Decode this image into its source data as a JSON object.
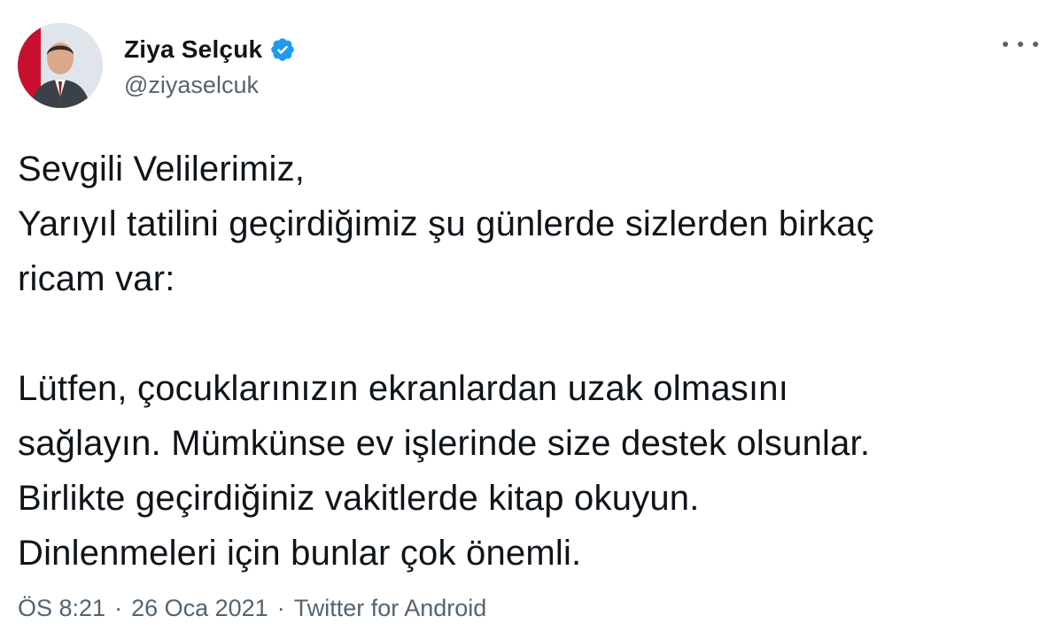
{
  "author": {
    "display_name": "Ziya Selçuk",
    "handle": "@ziyaselcuk",
    "verified": true,
    "avatar_icon": "profile-photo",
    "verified_color": "#1d9bf0"
  },
  "actions": {
    "more_icon": "more-horizontal-icon"
  },
  "tweet": {
    "lines": [
      "Sevgili Velilerimiz,",
      "Yarıyıl tatilini geçirdiğimiz şu günlerde sizlerden birkaç",
      "ricam var:",
      "Lütfen, çocuklarınızın ekranlardan uzak olmasını",
      "sağlayın. Mümkünse ev işlerinde size destek olsunlar.",
      "Birlikte geçirdiğiniz vakitlerde kitap okuyun.",
      "Dinlenmeleri için bunlar çok önemli."
    ]
  },
  "meta": {
    "time": "ÖS 8:21",
    "date": "26 Oca 2021",
    "source": "Twitter for Android",
    "separator": "·"
  }
}
